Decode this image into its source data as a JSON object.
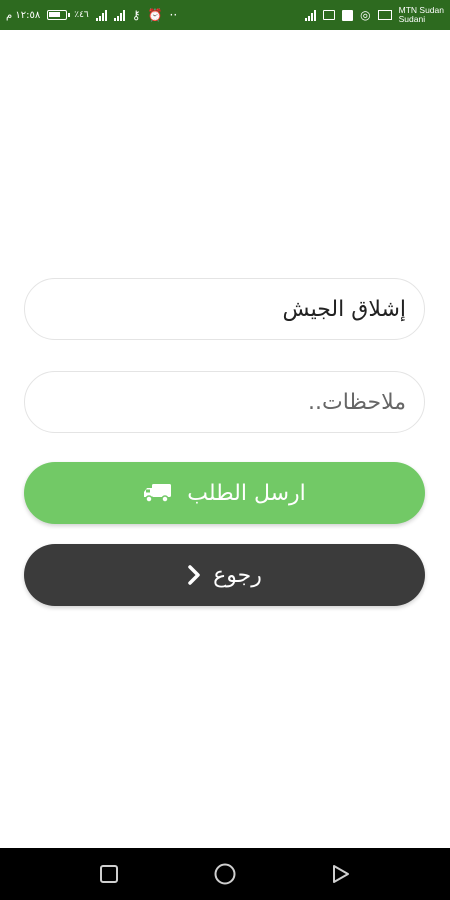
{
  "status_bar": {
    "time": "١٢:٥٨ م",
    "battery_percent": "٪٤٦",
    "network_label": "36",
    "carrier_line1": "MTN Sudan",
    "carrier_line2": "Sudani",
    "icons": [
      "battery-icon",
      "signal-icon",
      "key-icon",
      "alarm-icon",
      "dots-icon",
      "signal-bars-icon",
      "image-icon",
      "square-icon",
      "chat-icon",
      "mail-icon"
    ],
    "background": "#2d6a1f"
  },
  "form": {
    "address_value": "إشلاق الجيش",
    "notes_placeholder": "ملاحظات.."
  },
  "buttons": {
    "submit_label": "ارسل الطلب",
    "submit_icon": "delivery-truck-icon",
    "submit_color": "#72c966",
    "back_label": "رجوع",
    "back_icon": "chevron-right-icon",
    "back_color": "#3b3b3b"
  },
  "nav_bar": {
    "items": [
      "recents-icon",
      "home-icon",
      "back-icon"
    ]
  }
}
